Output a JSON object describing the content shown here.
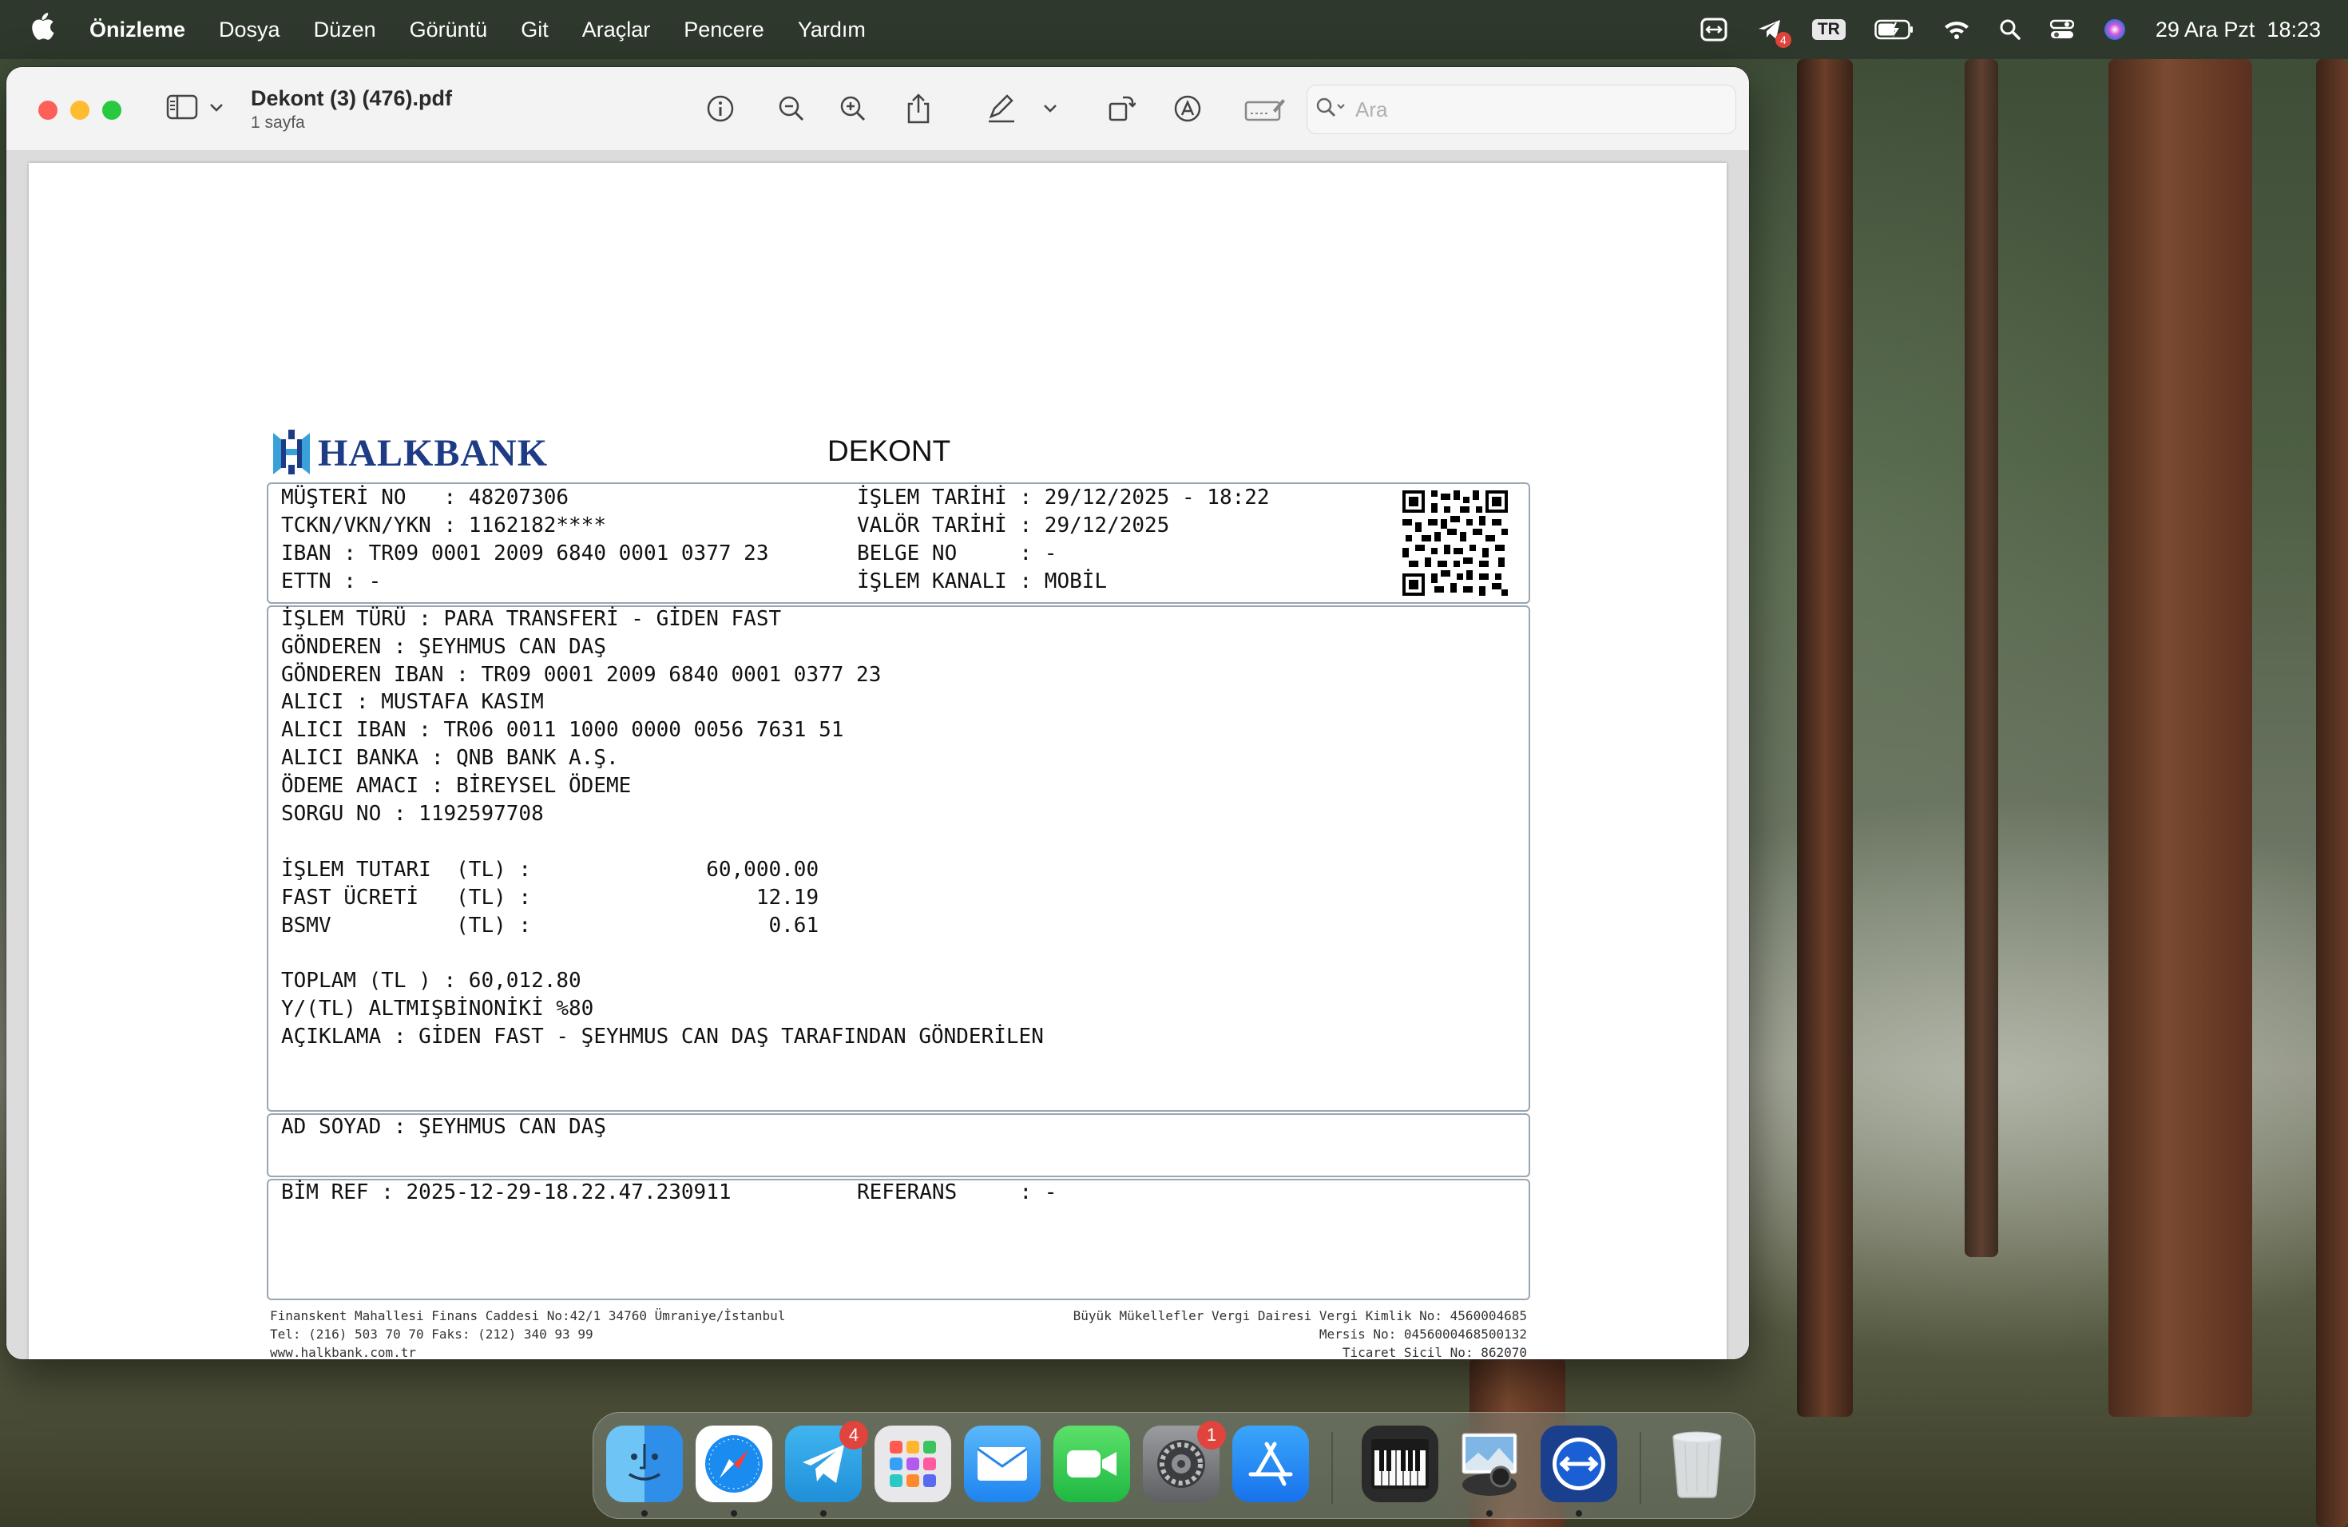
{
  "menubar": {
    "app_name": "Önizleme",
    "items": [
      "Dosya",
      "Düzen",
      "Görüntü",
      "Git",
      "Araçlar",
      "Pencere",
      "Yardım"
    ],
    "input_source": "TR",
    "telegram_badge": "4",
    "datetime": "29 Ara Pzt  18:23"
  },
  "window": {
    "title": "Dekont (3) (476).pdf",
    "subtitle": "1 sayfa",
    "search_placeholder": "Ara"
  },
  "receipt": {
    "bank_name": "HALKBANK",
    "heading": "DEKONT",
    "header_left": [
      "MÜŞTERİ NO   : 48207306",
      "TCKN/VKN/YKN : 1162182****",
      "IBAN : TR09 0001 2009 6840 0001 0377 23",
      "ETTN : -"
    ],
    "header_right": [
      "İŞLEM TARİHİ : 29/12/2025 - 18:22",
      "VALÖR TARİHİ : 29/12/2025",
      "BELGE NO     : -",
      "İŞLEM KANALI : MOBİL"
    ],
    "details": [
      "İŞLEM TÜRÜ : PARA TRANSFERİ - GİDEN FAST",
      "GÖNDEREN : ŞEYHMUS CAN DAŞ",
      "GÖNDEREN IBAN : TR09 0001 2009 6840 0001 0377 23",
      "ALICI : MUSTAFA KASIM",
      "ALICI IBAN : TR06 0011 1000 0000 0056 7631 51",
      "ALICI BANKA : QNB BANK A.Ş.",
      "ÖDEME AMACI : BİREYSEL ÖDEME",
      "SORGU NO : 1192597708"
    ],
    "amounts": [
      "İŞLEM TUTARI  (TL) :              60,000.00",
      "FAST ÜCRETİ   (TL) :                  12.19",
      "BSMV          (TL) :                   0.61"
    ],
    "totals": [
      "TOPLAM (TL ) : 60,012.80",
      "Y/(TL) ALTMIŞBİNONİKİ %80",
      "AÇIKLAMA : GİDEN FAST - ŞEYHMUS CAN DAŞ TARAFINDAN GÖNDERİLEN"
    ],
    "signature": "AD SOYAD : ŞEYHMUS CAN DAŞ",
    "bim_ref": "BİM REF : 2025-12-29-18.22.47.230911",
    "referans": "REFERANS     : -",
    "footer_left": [
      "Finanskent Mahallesi Finans Caddesi No:42/1 34760 Ümraniye/İstanbul",
      "Tel: (216) 503 70 70 Faks: (212) 340 93 99",
      "www.halkbank.com.tr"
    ],
    "footer_right": [
      "Büyük Mükellefler Vergi Dairesi Vergi Kimlik No: 4560004685",
      "Mersis No: 0456000468500132",
      "Ticaret Sicil No: 862070"
    ]
  },
  "dock": {
    "apps": [
      {
        "name": "Finder",
        "icon": "finder-icon"
      },
      {
        "name": "Safari",
        "icon": "safari-icon"
      },
      {
        "name": "Telegram",
        "icon": "telegram-icon",
        "badge": "4"
      },
      {
        "name": "Launchpad",
        "icon": "launchpad-icon"
      },
      {
        "name": "Mail",
        "icon": "mail-icon"
      },
      {
        "name": "FaceTime",
        "icon": "facetime-icon"
      },
      {
        "name": "Sistem Ayarları",
        "icon": "settings-icon",
        "badge": "1"
      },
      {
        "name": "App Store",
        "icon": "appstore-icon"
      },
      {
        "name": "Piano",
        "icon": "piano-icon"
      },
      {
        "name": "Önizleme",
        "icon": "preview-icon"
      },
      {
        "name": "TeamViewer",
        "icon": "teamviewer-icon"
      },
      {
        "name": "Çöp Sepeti",
        "icon": "trash-icon"
      }
    ]
  }
}
